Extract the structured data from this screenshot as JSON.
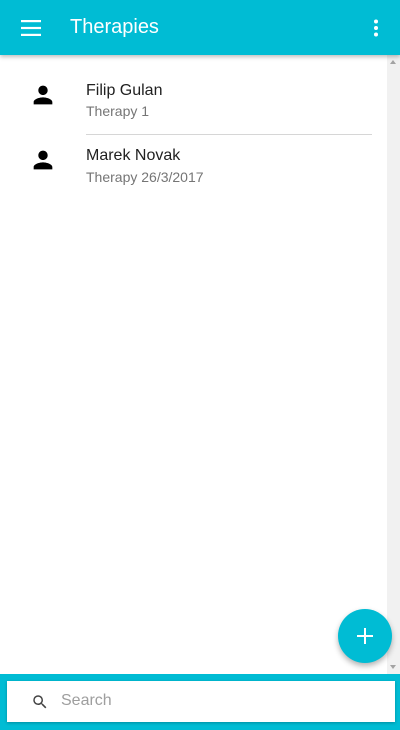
{
  "appbar": {
    "title": "Therapies",
    "menu_icon": "menu-icon",
    "more_icon": "more-vert-icon",
    "background_color": "#00bcd4"
  },
  "list": {
    "items": [
      {
        "name": "Filip Gulan",
        "subtitle": "Therapy 1",
        "icon": "person-icon"
      },
      {
        "name": "Marek Novak",
        "subtitle": "Therapy 26/3/2017",
        "icon": "person-icon"
      }
    ]
  },
  "fab": {
    "icon": "add-icon",
    "color": "#00bcd4"
  },
  "search": {
    "placeholder": "Search",
    "value": "",
    "icon": "search-icon"
  }
}
